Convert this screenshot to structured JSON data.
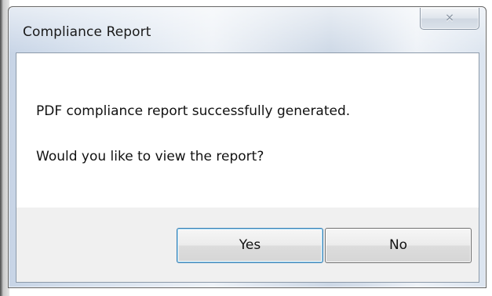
{
  "dialog": {
    "title": "Compliance Report",
    "close_icon": "close-icon",
    "close_glyph": "✕"
  },
  "message": {
    "line1": "PDF compliance report successfully generated.",
    "line2": "Would you like to view the report?"
  },
  "buttons": {
    "yes": "Yes",
    "no": "No"
  },
  "colors": {
    "default_button_border": "#3c7fb1",
    "button_area_bg": "#f0f0f0"
  }
}
